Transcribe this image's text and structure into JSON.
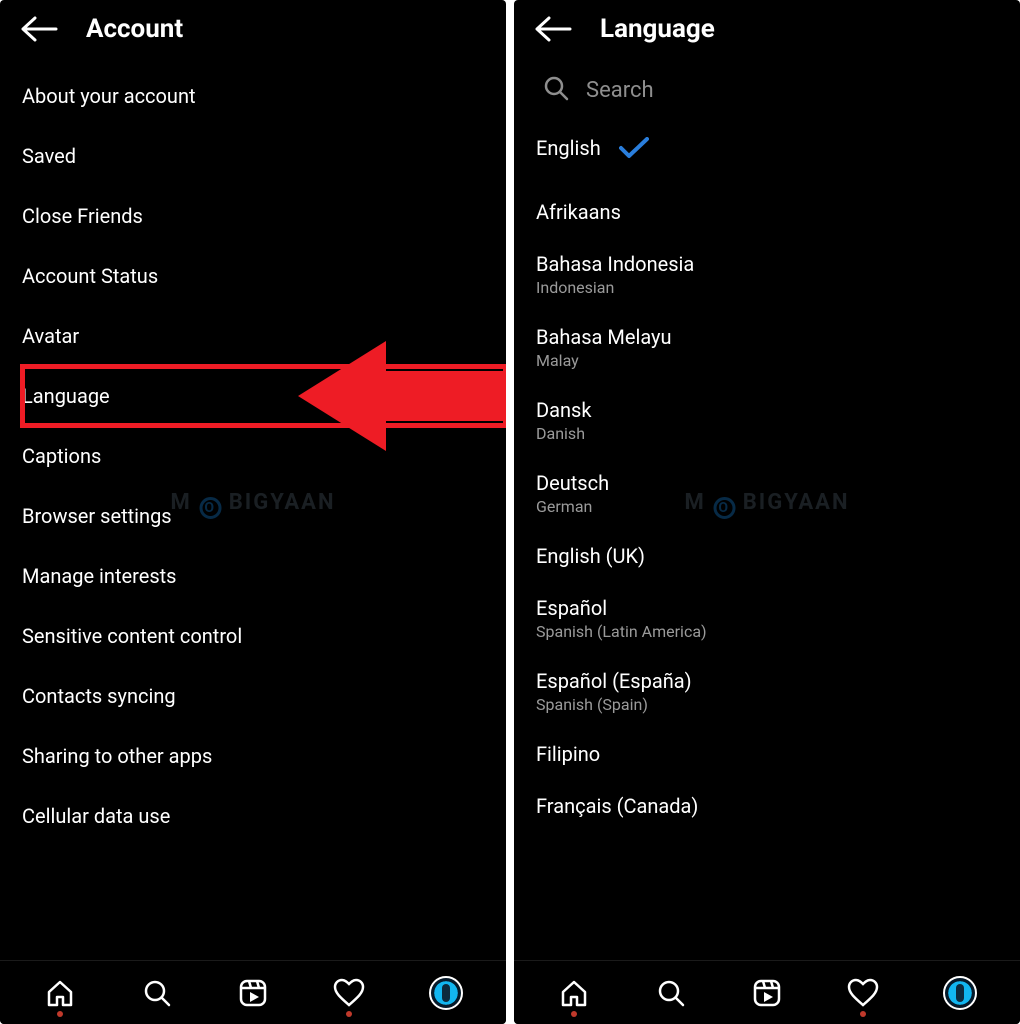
{
  "left": {
    "title": "Account",
    "items": [
      "About your account",
      "Saved",
      "Close Friends",
      "Account Status",
      "Avatar",
      "Language",
      "Captions",
      "Browser settings",
      "Manage interests",
      "Sensitive content control",
      "Contacts syncing",
      "Sharing to other apps",
      "Cellular data use"
    ],
    "highlighted_index": 5
  },
  "right": {
    "title": "Language",
    "search_placeholder": "Search",
    "selected": "English",
    "languages": [
      {
        "native": "English",
        "english": "",
        "selected": true
      },
      {
        "native": "Afrikaans",
        "english": ""
      },
      {
        "native": "Bahasa Indonesia",
        "english": "Indonesian"
      },
      {
        "native": "Bahasa Melayu",
        "english": "Malay"
      },
      {
        "native": "Dansk",
        "english": "Danish"
      },
      {
        "native": "Deutsch",
        "english": "German"
      },
      {
        "native": "English (UK)",
        "english": ""
      },
      {
        "native": "Español",
        "english": "Spanish (Latin America)"
      },
      {
        "native": "Español (España)",
        "english": "Spanish (Spain)"
      },
      {
        "native": "Filipino",
        "english": ""
      },
      {
        "native": "Français (Canada)",
        "english": ""
      }
    ]
  },
  "watermark": "M   BIGYAAN",
  "colors": {
    "highlight": "#ee1c25",
    "check": "#2a7edc"
  }
}
